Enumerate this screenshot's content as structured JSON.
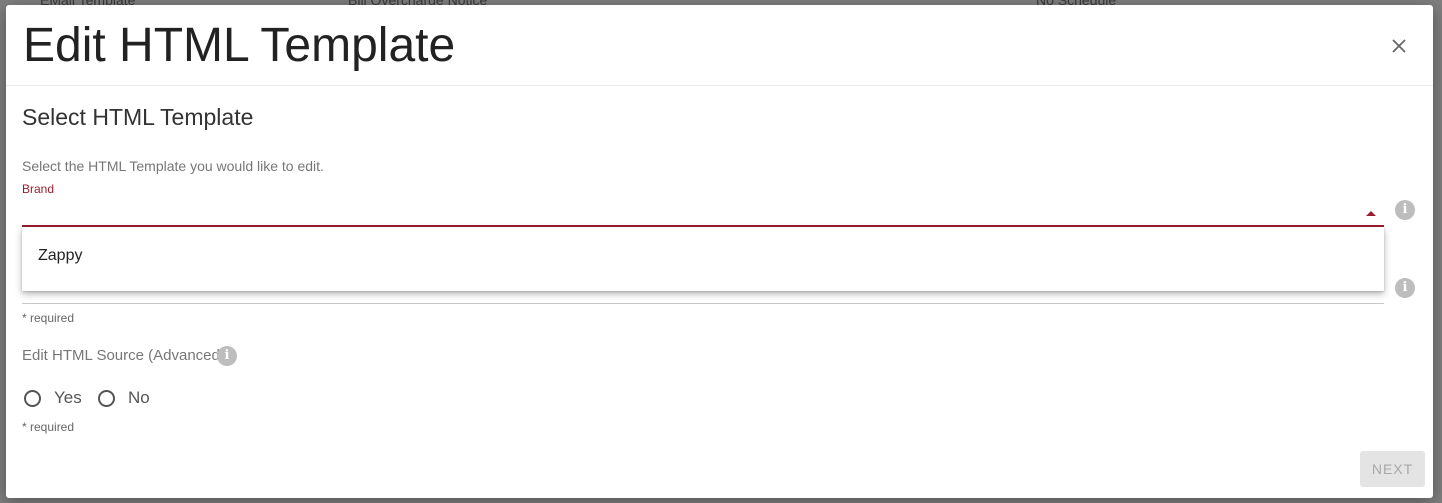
{
  "background": {
    "row": [
      "EMail Template",
      "Bill Overcharge Notice",
      "No Schedule"
    ]
  },
  "modal": {
    "title": "Edit HTML Template",
    "close_icon": "close-icon",
    "section_title": "Select HTML Template",
    "instruction": "Select the HTML Template you would like to edit.",
    "brand": {
      "label": "Brand",
      "value": "",
      "options": [
        "Zappy"
      ],
      "info_icon": "info-icon"
    },
    "template_field": {
      "value": "",
      "required_text": "* required",
      "info_icon": "info-icon"
    },
    "advanced": {
      "label": "Edit HTML Source (Advanced)",
      "options": [
        "Yes",
        "No"
      ],
      "selected": null,
      "required_text": "* required"
    },
    "next_label": "NEXT",
    "colors": {
      "accent": "#9b1c2e",
      "info_icon": "#bdbdbd",
      "disabled_button_bg": "#e4e4e4"
    }
  }
}
